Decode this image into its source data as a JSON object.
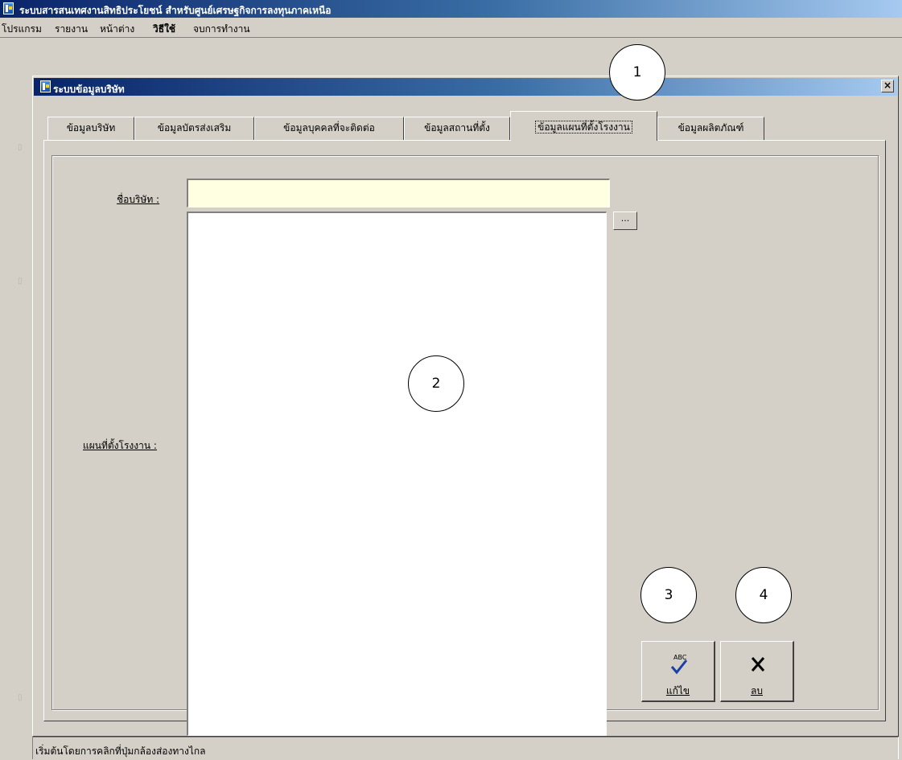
{
  "app": {
    "title": "ระบบสารสนเทศงานสิทธิประโยชน์ สำหรับศูนย์เศรษฐกิจการลงทุนภาคเหนือ"
  },
  "menu": [
    "โปรแกรม",
    "รายงาน",
    "หน้าต่าง",
    "วิธีใช้",
    "จบการทำงาน"
  ],
  "window": {
    "title": "ระบบข้อมูลบริษัท",
    "close_glyph": "×"
  },
  "tabs": [
    {
      "label": "ข้อมูลบริษัท",
      "active": false
    },
    {
      "label": "ข้อมูลบัตรส่งเสริม",
      "active": false
    },
    {
      "label": "ข้อมูลบุคคลที่จะติดต่อ",
      "active": false
    },
    {
      "label": "ข้อมูลสถานที่ตั้ง",
      "active": false
    },
    {
      "label": "ข้อมูลแผนที่ตั้งโรงงาน",
      "active": true
    },
    {
      "label": "ข้อมูลผลิตภัณฑ์",
      "active": false
    }
  ],
  "form": {
    "company_label": "ชื่อบริษัท :",
    "company_value": "",
    "map_label": "แผนที่ตั้งโรงงาน :",
    "browse_label": "..."
  },
  "buttons": {
    "edit": {
      "icon": "spellcheck-icon",
      "label": "แก้ไข"
    },
    "delete": {
      "icon": "x-delete-icon",
      "label": "ลบ"
    }
  },
  "callouts": [
    "1",
    "2",
    "3",
    "4"
  ],
  "status": {
    "text": "เริ่มต้นโดยการคลิกที่ปุ่มกล้องส่องทางไกล"
  },
  "colors": {
    "title_bar_start": "#0a246a",
    "title_bar_end": "#a6caf0",
    "face": "#d4d0c8",
    "input_bg": "#ffffe1"
  }
}
